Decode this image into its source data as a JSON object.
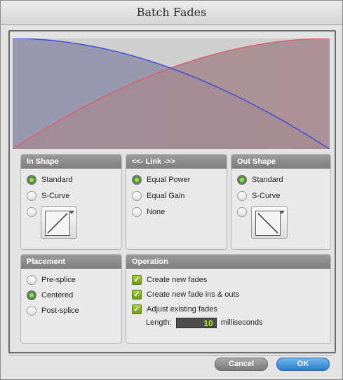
{
  "window": {
    "title": "Batch Fades"
  },
  "colors": {
    "fade_in_curve": "#d9606e",
    "fade_out_curve": "#3f4fd6",
    "graph_fill_left": "#8e8ea8",
    "graph_fill_right": "#a88a8e",
    "checkbox_green": "#8dbb2b",
    "ok_blue": "#3d8fd8",
    "length_text": "#b5ee2a"
  },
  "in_shape": {
    "header": "In Shape",
    "options": [
      {
        "label": "Standard",
        "selected": true
      },
      {
        "label": "S-Curve",
        "selected": false
      },
      {
        "label": "",
        "selected": false
      }
    ],
    "custom_shape_icon": "linear-fade-in-icon"
  },
  "link": {
    "header": "<<- Link ->>",
    "options": [
      {
        "label": "Equal Power",
        "selected": true
      },
      {
        "label": "Equal Gain",
        "selected": false
      },
      {
        "label": "None",
        "selected": false
      }
    ]
  },
  "out_shape": {
    "header": "Out Shape",
    "options": [
      {
        "label": "Standard",
        "selected": true
      },
      {
        "label": "S-Curve",
        "selected": false
      },
      {
        "label": "",
        "selected": false
      }
    ],
    "custom_shape_icon": "linear-fade-out-icon"
  },
  "placement": {
    "header": "Placement",
    "options": [
      {
        "label": "Pre-splice",
        "selected": false
      },
      {
        "label": "Centered",
        "selected": true
      },
      {
        "label": "Post-splice",
        "selected": false
      }
    ]
  },
  "operation": {
    "header": "Operation",
    "checks": [
      {
        "label": "Create new fades",
        "checked": true
      },
      {
        "label": "Create new fade ins & outs",
        "checked": true
      },
      {
        "label": "Adjust existing fades",
        "checked": true
      }
    ],
    "length_label": "Length:",
    "length_value": "10",
    "length_units": "milliseconds"
  },
  "buttons": {
    "cancel": "Cancel",
    "ok": "OK"
  }
}
